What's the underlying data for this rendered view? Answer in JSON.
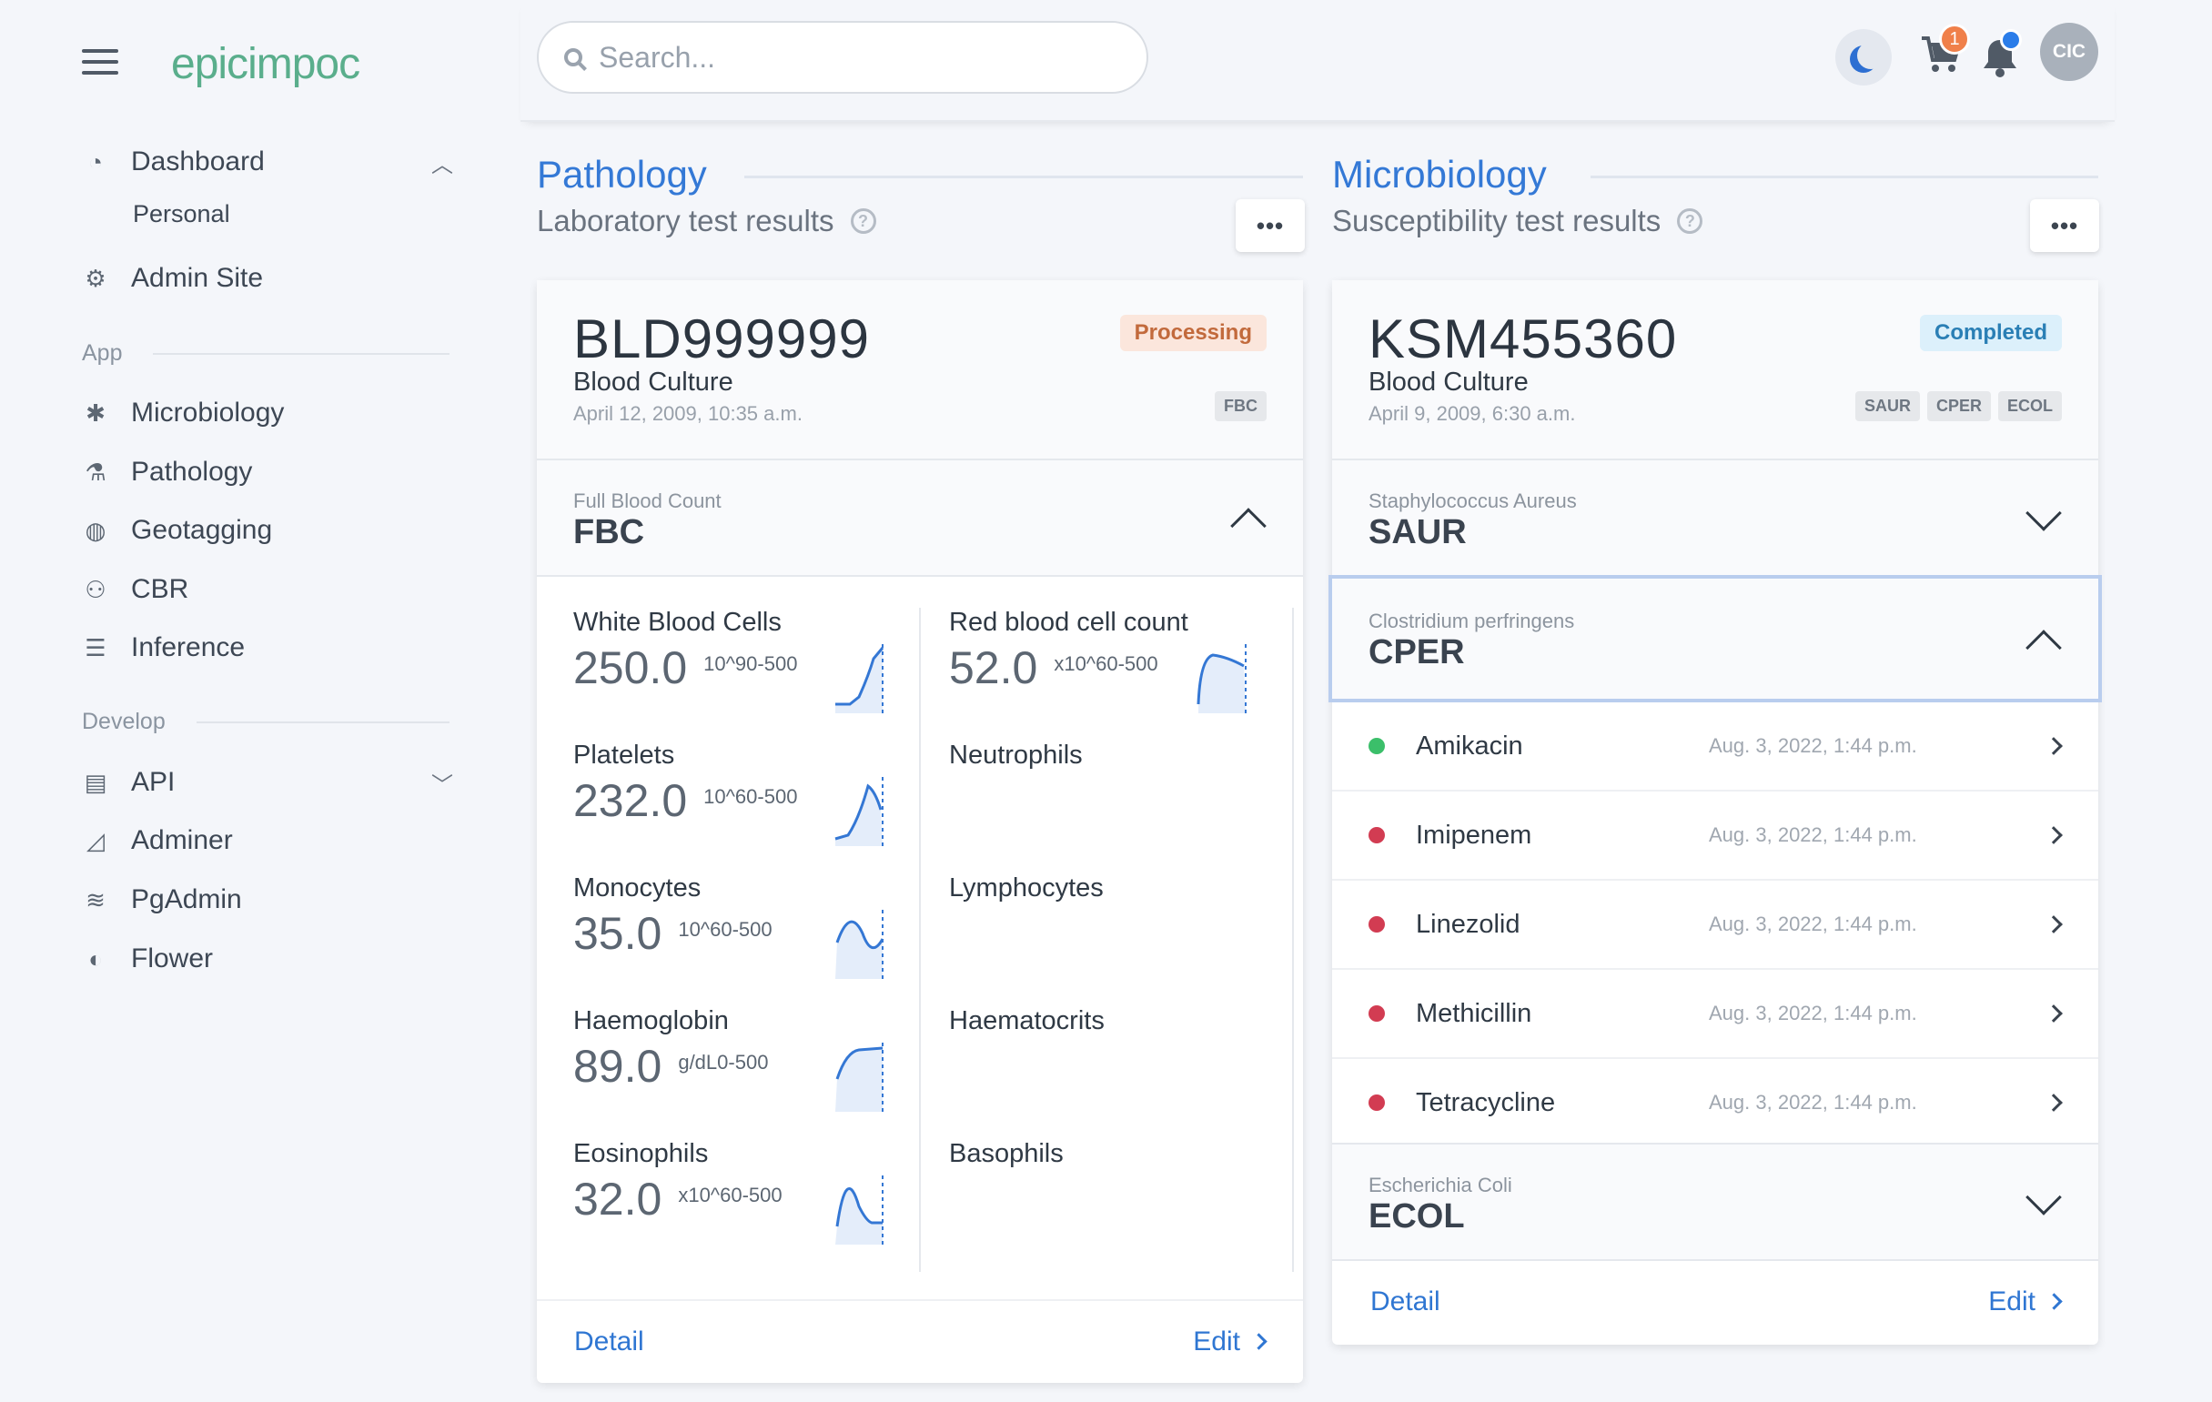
{
  "brand": {
    "logo_left": "epic",
    "logo_right": "impoc"
  },
  "search": {
    "placeholder": "Search..."
  },
  "header": {
    "cart_count": "1",
    "avatar": "CIC"
  },
  "sidebar": {
    "dashboard": "Dashboard",
    "personal": "Personal",
    "admin": "Admin Site",
    "app_section": "App",
    "app_items": [
      "Microbiology",
      "Pathology",
      "Geotagging",
      "CBR",
      "Inference"
    ],
    "develop_section": "Develop",
    "dev_items": [
      "API",
      "Adminer",
      "PgAdmin",
      "Flower"
    ]
  },
  "pathology": {
    "title": "Pathology",
    "subtitle": "Laboratory test results",
    "more": "•••",
    "id": "BLD999999",
    "status": "Processing",
    "type": "Blood Culture",
    "date": "April 12, 2009, 10:35 a.m.",
    "tags": [
      "FBC"
    ],
    "group_name": "Full Blood Count",
    "group_code": "FBC",
    "left_metrics": [
      {
        "name": "White Blood Cells",
        "value": "250.0",
        "unit": "10^9",
        "range": "0-500"
      },
      {
        "name": "Platelets",
        "value": "232.0",
        "unit": "10^6",
        "range": "0-500"
      },
      {
        "name": "Monocytes",
        "value": "35.0",
        "unit": "10^6",
        "range": "0-500"
      },
      {
        "name": "Haemoglobin",
        "value": "89.0",
        "unit": "g/dL",
        "range": "0-500"
      },
      {
        "name": "Eosinophils",
        "value": "32.0",
        "unit": "x10^6",
        "range": "0-500"
      }
    ],
    "right_metrics": [
      {
        "name": "Red blood cell count",
        "value": "52.0",
        "unit": "x10^6",
        "range": "0-500"
      },
      {
        "name": "Neutrophils"
      },
      {
        "name": "Lymphocytes"
      },
      {
        "name": "Haematocrits"
      },
      {
        "name": "Basophils"
      }
    ],
    "detail": "Detail",
    "edit": "Edit"
  },
  "microbiology": {
    "title": "Microbiology",
    "subtitle": "Susceptibility test results",
    "more": "•••",
    "id": "KSM455360",
    "status": "Completed",
    "type": "Blood Culture",
    "date": "April 9, 2009, 6:30 a.m.",
    "tags": [
      "SAUR",
      "CPER",
      "ECOL"
    ],
    "groups": [
      {
        "name": "Staphylococcus Aureus",
        "code": "SAUR"
      },
      {
        "name": "Clostridium perfringens",
        "code": "CPER"
      },
      {
        "name": "Escherichia Coli",
        "code": "ECOL"
      }
    ],
    "antibiotics": [
      {
        "name": "Amikacin",
        "date": "Aug. 3, 2022, 1:44 p.m.",
        "color": "#3bbf6a"
      },
      {
        "name": "Imipenem",
        "date": "Aug. 3, 2022, 1:44 p.m.",
        "color": "#d23c52"
      },
      {
        "name": "Linezolid",
        "date": "Aug. 3, 2022, 1:44 p.m.",
        "color": "#d23c52"
      },
      {
        "name": "Methicillin",
        "date": "Aug. 3, 2022, 1:44 p.m.",
        "color": "#d23c52"
      },
      {
        "name": "Tetracycline",
        "date": "Aug. 3, 2022, 1:44 p.m.",
        "color": "#d23c52"
      }
    ],
    "detail": "Detail",
    "edit": "Edit"
  }
}
